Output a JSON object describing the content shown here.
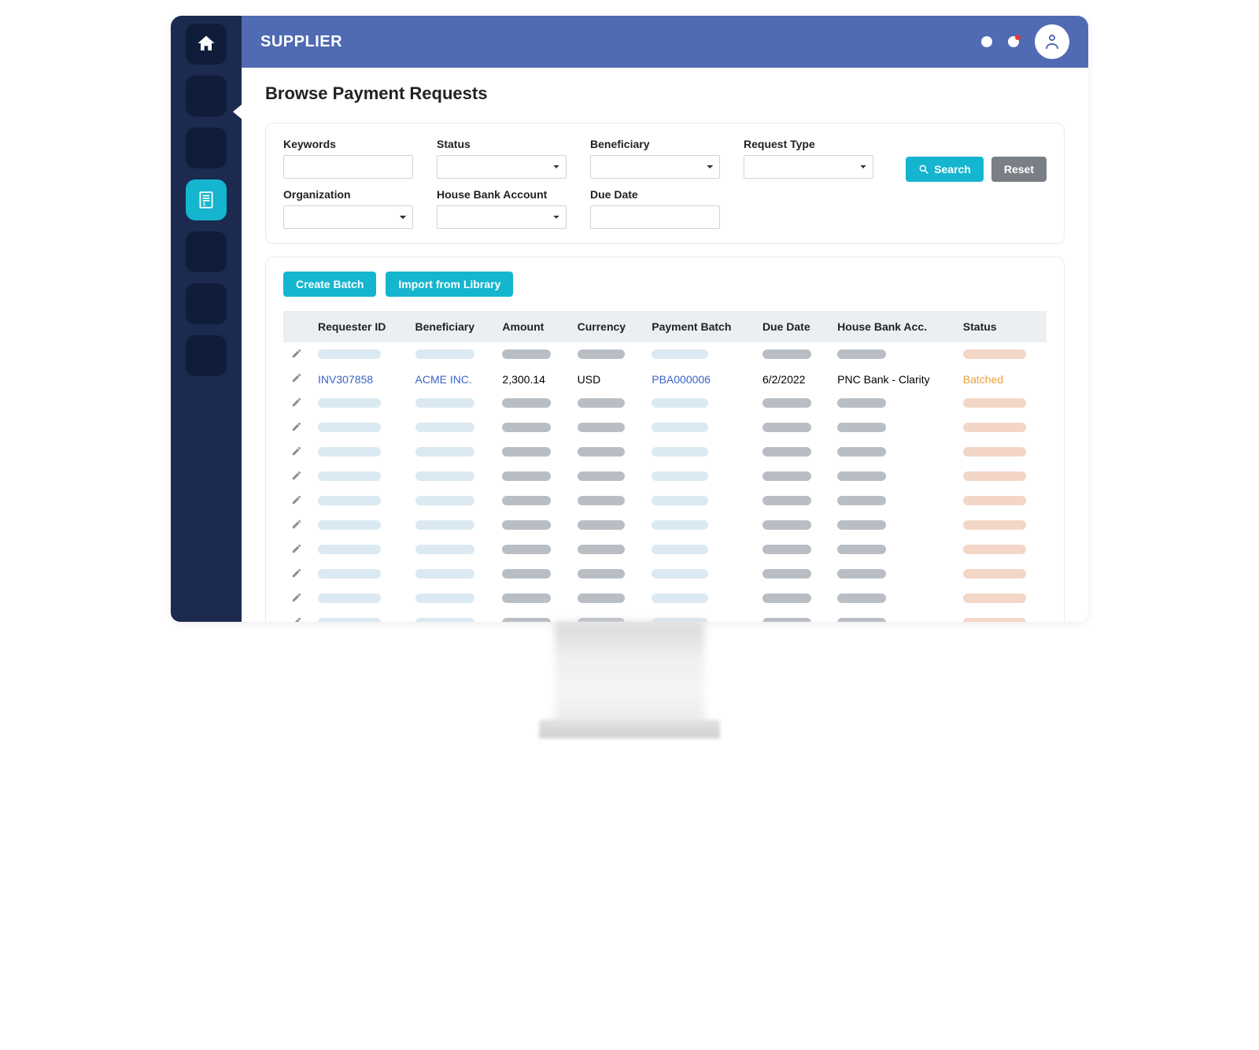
{
  "topbar": {
    "title": "SUPPLIER",
    "icons": {
      "notification": "notification-icon",
      "bell": "bell-icon",
      "user": "user-icon"
    }
  },
  "sidebar": {
    "items": [
      {
        "name": "home",
        "active": false
      },
      {
        "name": "dashboard",
        "active": false,
        "pointer": true
      },
      {
        "name": "module-1",
        "active": false
      },
      {
        "name": "payment-requests",
        "active": true
      },
      {
        "name": "module-3",
        "active": false
      },
      {
        "name": "module-4",
        "active": false
      },
      {
        "name": "module-5",
        "active": false
      }
    ]
  },
  "page": {
    "title": "Browse Payment Requests"
  },
  "filters": {
    "keywords": {
      "label": "Keywords",
      "value": ""
    },
    "status": {
      "label": "Status",
      "value": ""
    },
    "beneficiary": {
      "label": "Beneficiary",
      "value": ""
    },
    "request_type": {
      "label": "Request Type",
      "value": ""
    },
    "organization": {
      "label": "Organization",
      "value": ""
    },
    "house_bank_account": {
      "label": "House Bank Account",
      "value": ""
    },
    "due_date": {
      "label": "Due Date",
      "value": ""
    },
    "search_label": "Search",
    "reset_label": "Reset"
  },
  "actions": {
    "create_batch": "Create Batch",
    "import_library": "Import from Library"
  },
  "table": {
    "columns": {
      "requester_id": "Requester ID",
      "beneficiary": "Beneficiary",
      "amount": "Amount",
      "currency": "Currency",
      "payment_batch": "Payment Batch",
      "due_date": "Due Date",
      "house_bank_acc": "House Bank Acc.",
      "status": "Status"
    },
    "visible_row": {
      "requester_id": "INV307858",
      "beneficiary": "ACME INC.",
      "amount": "2,300.14",
      "currency": "USD",
      "payment_batch": "PBA000006",
      "due_date": "6/2/2022",
      "house_bank_acc": "PNC Bank - Clarity",
      "status": "Batched"
    },
    "placeholder_rows_before": 1,
    "placeholder_rows_after": 10
  },
  "colors": {
    "accent": "#15b5cf",
    "header": "#506bb3",
    "sidebar": "#1b2a4e",
    "sidebar_tile": "#0f1d3b",
    "link": "#3a63c6",
    "status_batched": "#e6a23c"
  }
}
